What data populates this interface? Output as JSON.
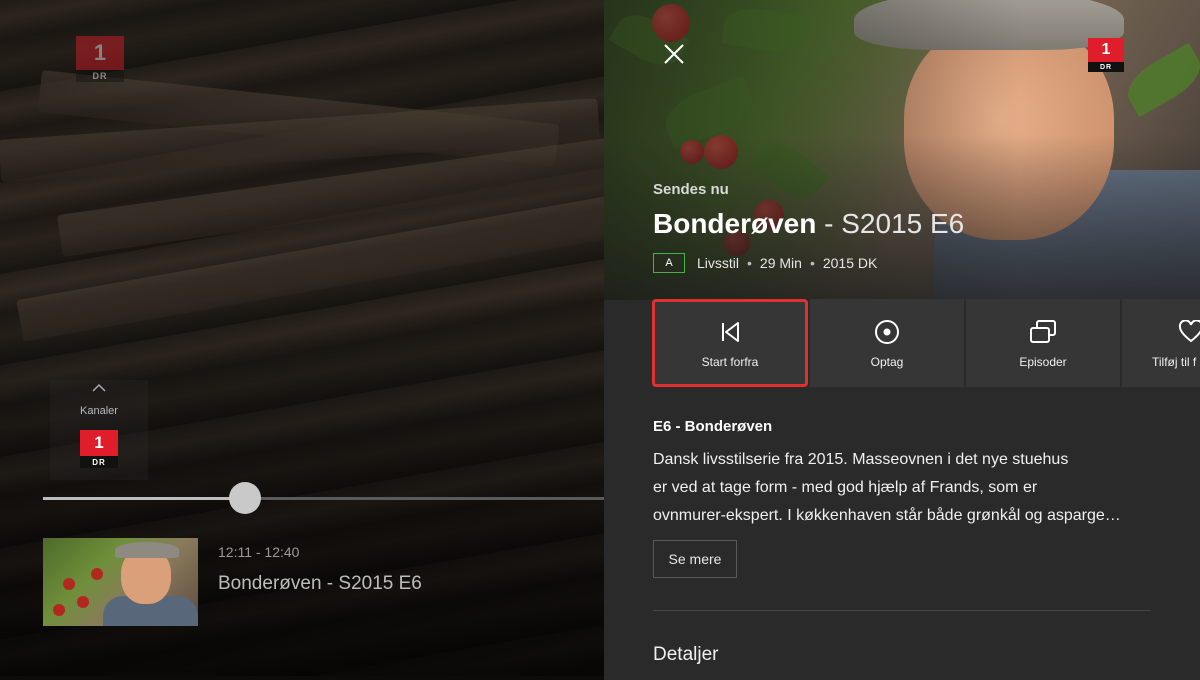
{
  "player": {
    "channels_label": "Kanaler",
    "channel_logo": {
      "number": "1",
      "brand": "DR"
    },
    "progress": 0.36,
    "program": {
      "time": "12:11 - 12:40",
      "title": "Bonderøven - S2015 E6"
    }
  },
  "panel": {
    "close_icon": "close-icon",
    "channel_logo": {
      "number": "1",
      "brand": "DR"
    },
    "status": "Sendes nu",
    "title_main": "Bonderøven",
    "title_episode": " - S2015 E6",
    "rating": "A",
    "genre": "Livsstil",
    "duration": "29 Min",
    "year_country": "2015 DK",
    "actions": [
      {
        "label": "Start forfra",
        "icon": "restart-icon"
      },
      {
        "label": "Optag",
        "icon": "record-icon"
      },
      {
        "label": "Episoder",
        "icon": "episodes-icon"
      },
      {
        "label": "Tilføj til f",
        "icon": "heart-icon"
      }
    ],
    "episode_title": "E6 - Bonderøven",
    "description_lines": [
      "Dansk livsstilserie fra 2015. Masseovnen i det nye stuehus",
      "er ved at tage form - med god hjælp af Frands, som er",
      "ovnmurer-ekspert. I køkkenhaven står både grønkål og asparge…"
    ],
    "see_more": "Se mere",
    "details_heading": "Detaljer"
  },
  "colors": {
    "accent_selected": "#e03030",
    "rating_border": "#47b04b",
    "dr_red": "#e01e2b"
  }
}
